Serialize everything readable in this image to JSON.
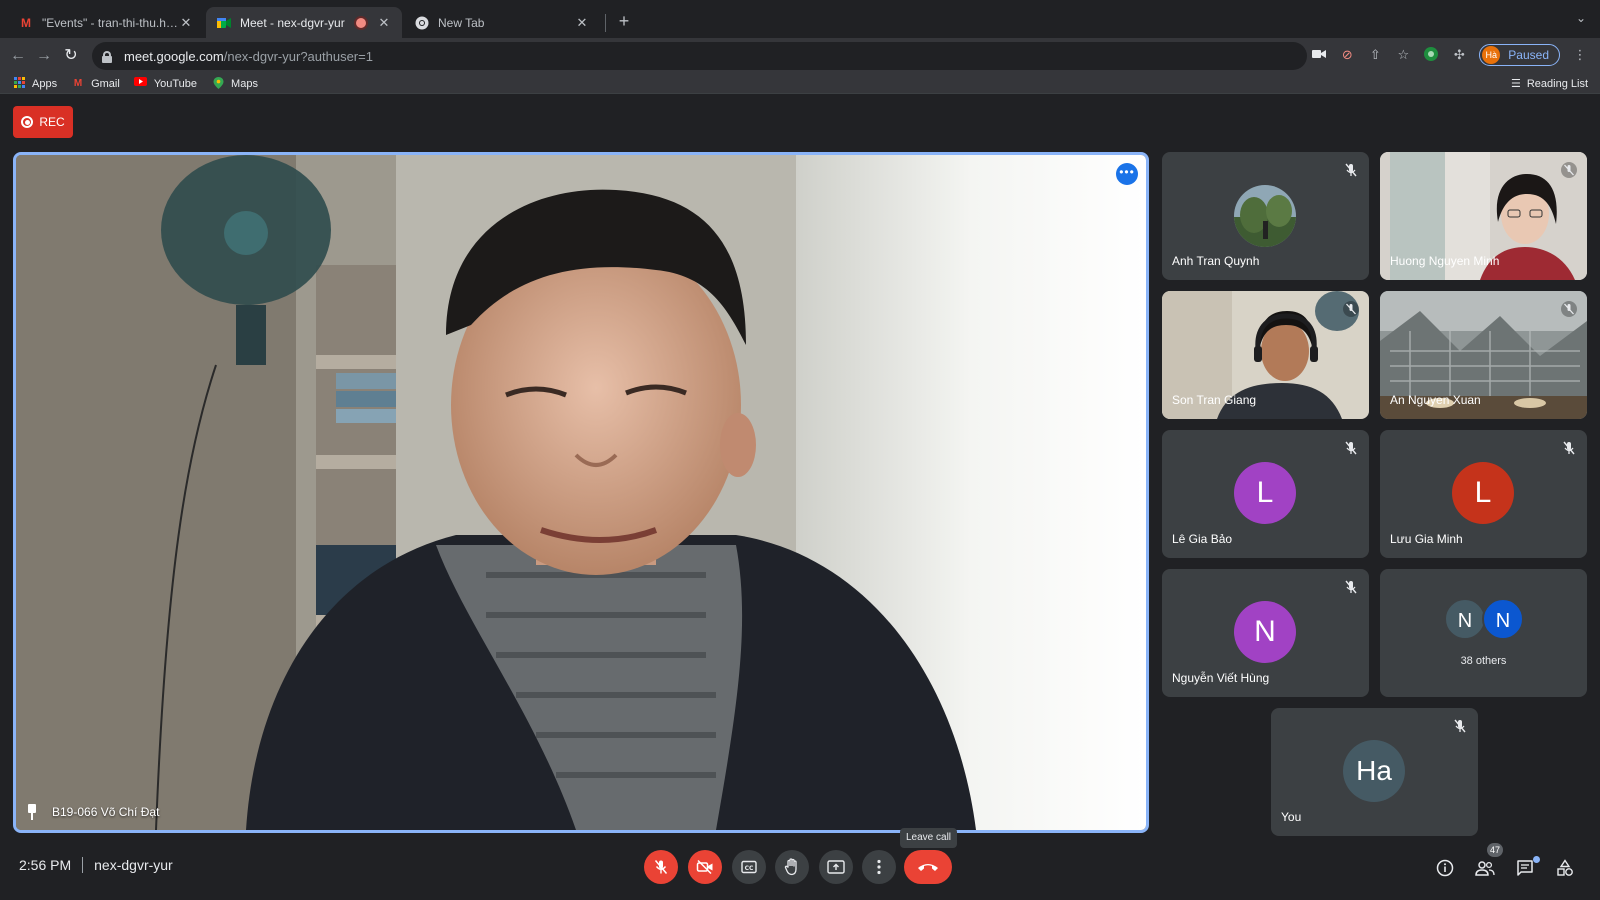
{
  "browser": {
    "tabs": [
      {
        "title": "\"Events\" - tran-thi-thu.ha@ust",
        "favicon": "gmail-icon"
      },
      {
        "title": "Meet - nex-dgvr-yur",
        "favicon": "meet-icon",
        "recording": true
      },
      {
        "title": "New Tab",
        "favicon": "chrome-icon"
      }
    ],
    "url_host": "meet.google.com",
    "url_path": "/nex-dgvr-yur?authuser=1",
    "profile_initials": "Hà",
    "profile_status": "Paused",
    "bookmarks": [
      "Apps",
      "Gmail",
      "YouTube",
      "Maps"
    ],
    "reading_list": "Reading List"
  },
  "meet": {
    "rec_label": "REC",
    "main_speaker": "B19-066 Võ Chí Đạt",
    "main_more": "•••",
    "participants": [
      {
        "name": "Anh Tran Quynh"
      },
      {
        "name": "Huong Nguyen Minh"
      },
      {
        "name": "Son Tran Giang"
      },
      {
        "name": "An Nguyen Xuan"
      },
      {
        "name": "Lê Gia Bảo",
        "initial": "L",
        "color": "#a142c4"
      },
      {
        "name": "Lưu Gia Minh",
        "initial": "L",
        "color": "#c5331b"
      },
      {
        "name": "Nguyễn Viết Hùng",
        "initial": "N",
        "color": "#a142c4"
      }
    ],
    "others": {
      "initials": [
        "N",
        "N"
      ],
      "colors": [
        "#455a64",
        "#0b57d0"
      ],
      "label": "38 others"
    },
    "self": {
      "name": "You",
      "initials": "Ha",
      "color": "#455a64"
    },
    "time": "2:56 PM",
    "meeting_code": "nex-dgvr-yur",
    "tooltip": "Leave call",
    "people_count": "47",
    "accent": "#8ab4f8",
    "danger": "#ea4335"
  }
}
